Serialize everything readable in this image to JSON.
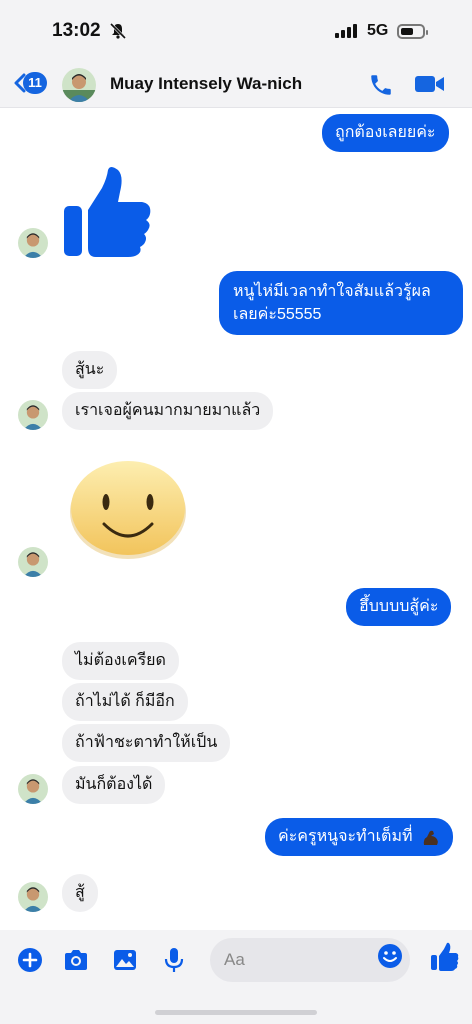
{
  "status_bar": {
    "time": "13:02",
    "network": "5G"
  },
  "header": {
    "back_count": "11",
    "contact_name": "Muay Intensely Wa-nich",
    "back_icon": "chevron-left-icon",
    "call_icon": "phone-icon",
    "video_icon": "video-camera-icon"
  },
  "messages": [
    {
      "side": "out",
      "text": "ถูกต้องเลยยค่ะ"
    },
    {
      "side": "in",
      "type": "sticker",
      "sticker": "large-thumbs-up"
    },
    {
      "side": "out",
      "text": "หนูไห่มีเวลาทำใจสัมแล้วรู้ผล เลยค่ะ55555",
      "line1": "หนูไห่มีเวลาทำใจสัมแล้วรู้ผล",
      "line2": "เลยค่ะ55555"
    },
    {
      "side": "in",
      "text": "สู้นะ"
    },
    {
      "side": "in",
      "text": "เราเจอผู้คนมากมายมาแล้ว"
    },
    {
      "side": "in",
      "type": "sticker",
      "sticker": "smiley-face"
    },
    {
      "side": "out",
      "text": "ฮึ้บบบบสู้ค่ะ"
    },
    {
      "side": "in",
      "text": "ไม่ต้องเครียด"
    },
    {
      "side": "in",
      "text": "ถ้าไม่ได้ ก็มีอีก"
    },
    {
      "side": "in",
      "text": "ถ้าฟ้าชะตาทำให้เป็น"
    },
    {
      "side": "in",
      "text": "มันก็ต้องได้"
    },
    {
      "side": "out",
      "text": "ค่ะครูหนูจะทำเต็มที่",
      "emoji": "flexed-biceps"
    },
    {
      "side": "in",
      "text": "สู้"
    }
  ],
  "composer": {
    "placeholder": "Aa",
    "icons": [
      "plus-circle-icon",
      "camera-icon",
      "image-icon",
      "microphone-icon",
      "emoji-icon",
      "thumbs-up-icon"
    ]
  },
  "colors": {
    "accent": "#0a5ce8",
    "incoming_bubble": "#efeff1",
    "bar_bg": "#f3f3f5"
  }
}
